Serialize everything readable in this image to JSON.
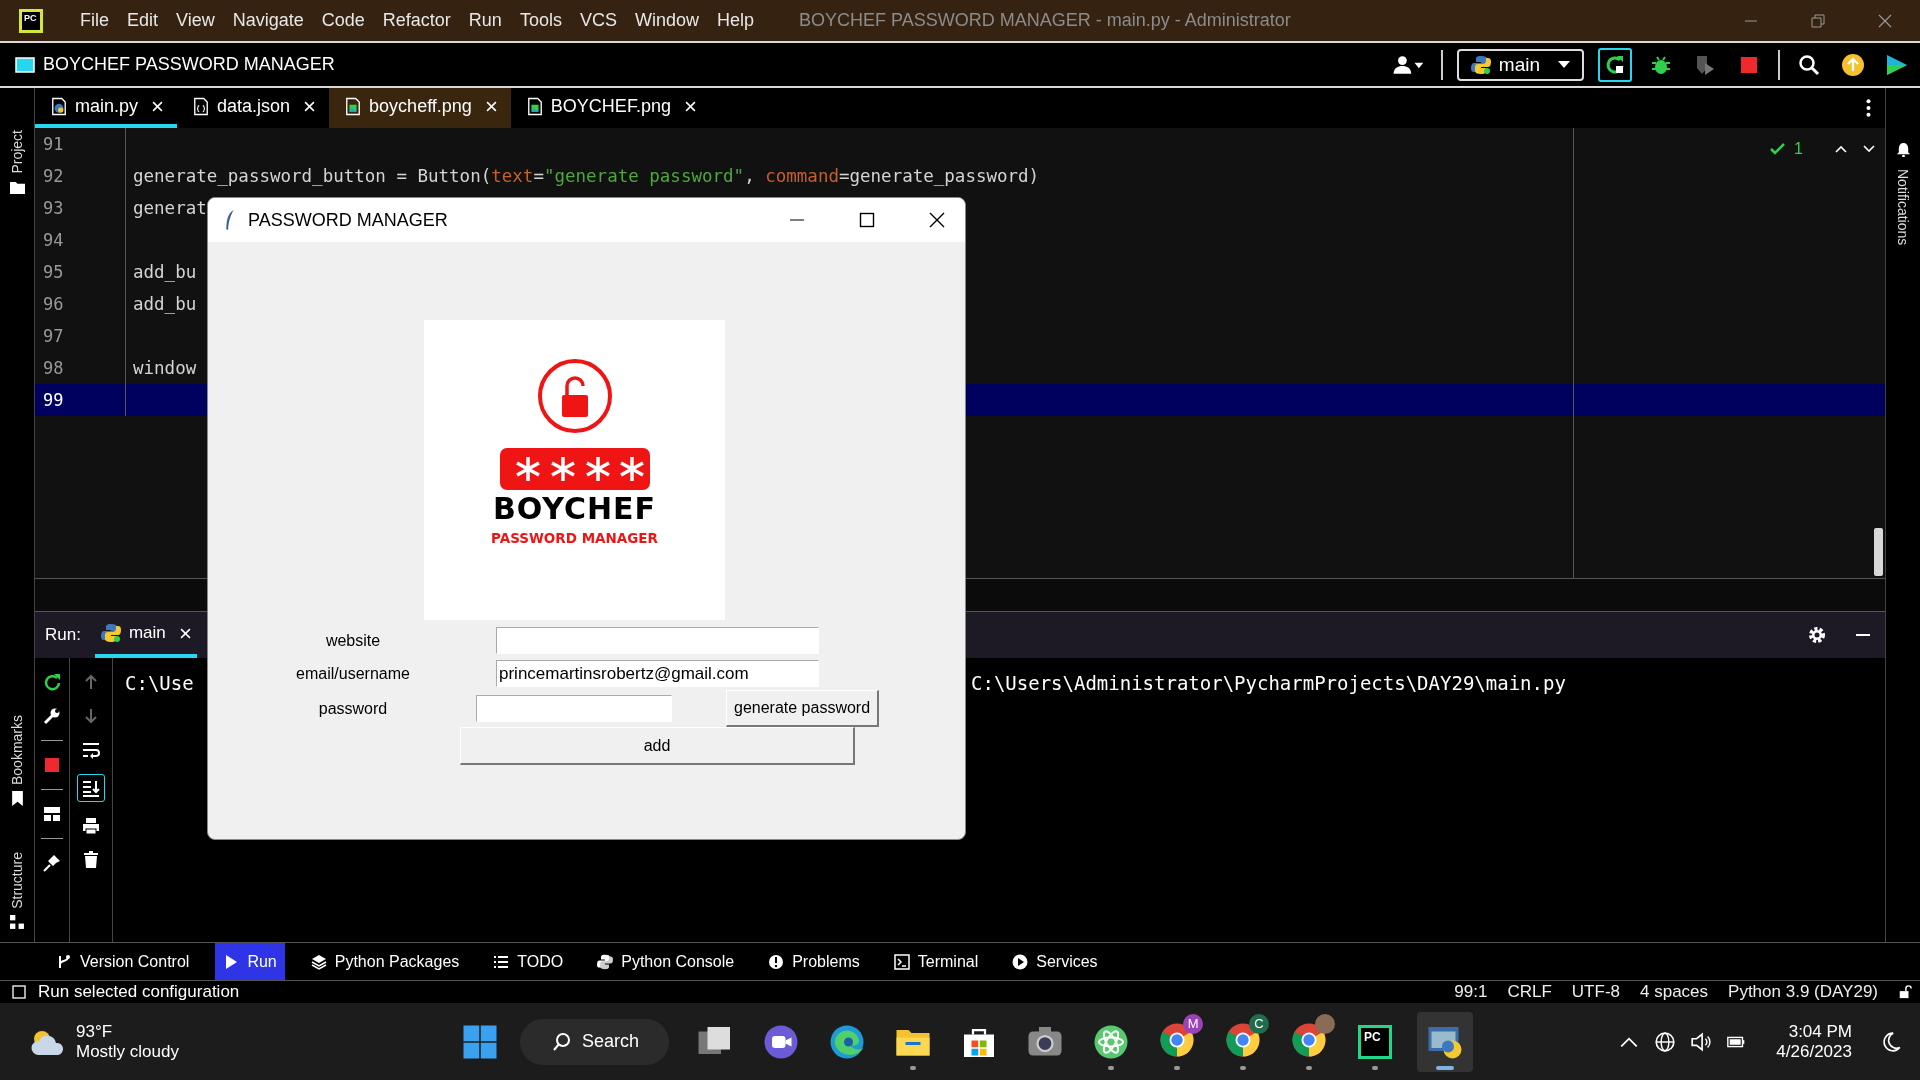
{
  "window": {
    "title": "BOYCHEF PASSWORD MANAGER - main.py - Administrator",
    "logo": "PC"
  },
  "menu": [
    "File",
    "Edit",
    "View",
    "Navigate",
    "Code",
    "Refactor",
    "Run",
    "Tools",
    "VCS",
    "Window",
    "Help"
  ],
  "project": {
    "name": "BOYCHEF PASSWORD MANAGER"
  },
  "run_config": {
    "name": "main"
  },
  "side_labels": {
    "project": "Project",
    "bookmarks": "Bookmarks",
    "structure": "Structure",
    "notifications": "Notifications"
  },
  "editor_tabs": [
    {
      "label": "main.py",
      "kind": "python",
      "selected": true,
      "hovered": false
    },
    {
      "label": "data.json",
      "kind": "json",
      "selected": false,
      "hovered": false
    },
    {
      "label": "boycheff.png",
      "kind": "image",
      "selected": false,
      "hovered": true
    },
    {
      "label": "BOYCHEF.png",
      "kind": "image",
      "selected": false,
      "hovered": false
    }
  ],
  "inspection": {
    "count": "1"
  },
  "code_lines": [
    {
      "number": "91",
      "current": false
    },
    {
      "number": "92",
      "current": false,
      "tokens": [
        {
          "text": "generate_password_button = Button(",
          "kind": "plain"
        },
        {
          "text": "text",
          "kind": "param"
        },
        {
          "text": "=",
          "kind": "plain"
        },
        {
          "text": "\"generate password\"",
          "kind": "string"
        },
        {
          "text": ", ",
          "kind": "plain"
        },
        {
          "text": "command",
          "kind": "param"
        },
        {
          "text": "=generate_password)",
          "kind": "plain"
        }
      ]
    },
    {
      "number": "93",
      "current": false,
      "tokens": [
        {
          "text": "generat",
          "kind": "plain"
        }
      ]
    },
    {
      "number": "94",
      "current": false
    },
    {
      "number": "95",
      "current": false,
      "tokens": [
        {
          "text": "add_bu",
          "kind": "plain"
        }
      ]
    },
    {
      "number": "96",
      "current": false,
      "tokens": [
        {
          "text": "add_bu",
          "kind": "plain"
        }
      ]
    },
    {
      "number": "97",
      "current": false
    },
    {
      "number": "98",
      "current": false,
      "tokens": [
        {
          "text": "window",
          "kind": "plain"
        }
      ]
    },
    {
      "number": "99",
      "current": true
    }
  ],
  "run_panel": {
    "label": "Run:",
    "tab": "main",
    "output": [
      "C:\\Use",
      "C:\\Users\\Administrator\\PycharmProjects\\DAY29\\main.py"
    ]
  },
  "tool_tabs": [
    {
      "label": "Version Control",
      "kind": "vcs",
      "selected": false
    },
    {
      "label": "Run",
      "kind": "run",
      "selected": true
    },
    {
      "label": "Python Packages",
      "kind": "packages",
      "selected": false
    },
    {
      "label": "TODO",
      "kind": "todo",
      "selected": false
    },
    {
      "label": "Python Console",
      "kind": "console",
      "selected": false
    },
    {
      "label": "Problems",
      "kind": "problems",
      "selected": false
    },
    {
      "label": "Terminal",
      "kind": "terminal",
      "selected": false
    },
    {
      "label": "Services",
      "kind": "services",
      "selected": false
    }
  ],
  "status_bar": {
    "message": "Run selected configuration",
    "items": [
      "99:1",
      "CRLF",
      "UTF-8",
      "4 spaces",
      "Python 3.9 (DAY29)"
    ]
  },
  "dialog": {
    "title": "PASSWORD MANAGER",
    "logo": {
      "title": "BOYCHEF",
      "subtitle": "PASSWORD MANAGER"
    },
    "fields": [
      {
        "label": "website",
        "kind": "wide"
      },
      {
        "label": "email/username",
        "value": "princemartinsrobertz@gmail.com",
        "kind": "wide"
      },
      {
        "label": "password",
        "kind": "short"
      }
    ],
    "generate_button": "generate password",
    "add_button": "add"
  },
  "taskbar": {
    "weather": {
      "temperature": "93°F",
      "condition": "Mostly cloudy"
    },
    "search": "Search",
    "apps": [
      {
        "kind": "taskview",
        "running": false,
        "active": false
      },
      {
        "kind": "chat",
        "running": false,
        "active": false
      },
      {
        "kind": "edge",
        "running": false,
        "active": false
      },
      {
        "kind": "explorer",
        "running": true,
        "active": false
      },
      {
        "kind": "store",
        "running": false,
        "active": false
      },
      {
        "kind": "camera",
        "running": false,
        "active": false
      },
      {
        "kind": "atom",
        "running": true,
        "active": false
      },
      {
        "kind": "chrome",
        "badge": "M",
        "running": true,
        "active": false
      },
      {
        "kind": "chrome",
        "badge": "C",
        "running": true,
        "active": false
      },
      {
        "kind": "chrome",
        "running": true,
        "active": false
      },
      {
        "kind": "pycharm",
        "label": "PC",
        "running": true,
        "active": false
      },
      {
        "kind": "python",
        "running": true,
        "active": true
      }
    ],
    "time": "3:04 PM",
    "date": "4/26/2023"
  }
}
